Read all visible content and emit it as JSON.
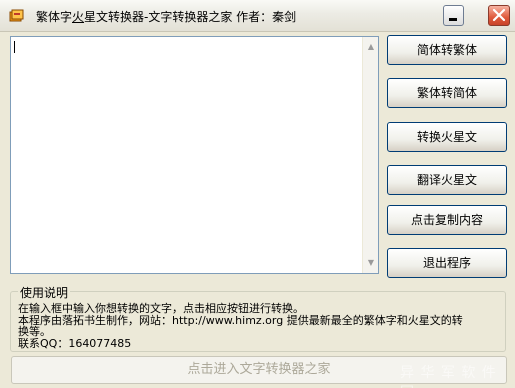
{
  "window": {
    "title_part1": "繁体字",
    "title_underlined": "火",
    "title_part2": "星文转换器-文字转换器之家  作者：秦剑"
  },
  "editor": {
    "value": ""
  },
  "buttons": {
    "simp_to_trad": "简体转繁体",
    "trad_to_simp": "繁体转简体",
    "to_martian": "转换火星文",
    "translate_martian": "翻译火星文",
    "copy_content": "点击复制内容",
    "exit": "退出程序"
  },
  "instructions": {
    "legend": "使用说明",
    "line1": "在输入框中输入你想转换的文字，点击相应按钮进行转换。",
    "line2": "本程序由落拓书生制作，网站：http://www.himz.org 提供最新最全的繁体字和火星文的转",
    "line3": "换等。",
    "line4": "联系QQ：164077485"
  },
  "footer": {
    "enter_button": "点击进入文字转换器之家",
    "watermark": "异 华 军 软 件 园"
  },
  "colors": {
    "close_button": "#df5a3c",
    "window_bg": "#ece9d8",
    "button_border": "#003c74"
  }
}
